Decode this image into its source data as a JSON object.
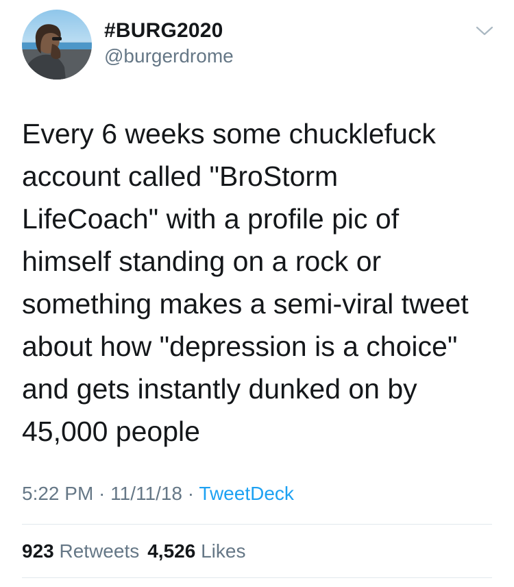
{
  "user": {
    "display_name": "#BURG2020",
    "handle": "@burgerdrome"
  },
  "tweet": {
    "text": "Every 6 weeks some chucklefuck\naccount called \"BroStorm\nLifeCoach\" with a profile pic of\nhimself standing on a rock or\nsomething makes a semi-viral tweet\nabout how \"depression is a choice\"\nand gets instantly dunked on by\n45,000 people",
    "time": "5:22 PM",
    "separator": " · ",
    "date": "11/11/18",
    "source": "TweetDeck"
  },
  "stats": {
    "retweets_count": "923",
    "retweets_label": "Retweets",
    "likes_count": "4,526",
    "likes_label": "Likes"
  },
  "icons": {
    "menu": "chevron-down-icon"
  },
  "colors": {
    "text": "#14171a",
    "secondary": "#657786",
    "link": "#1da1f2",
    "divider": "#e1e8ed"
  }
}
